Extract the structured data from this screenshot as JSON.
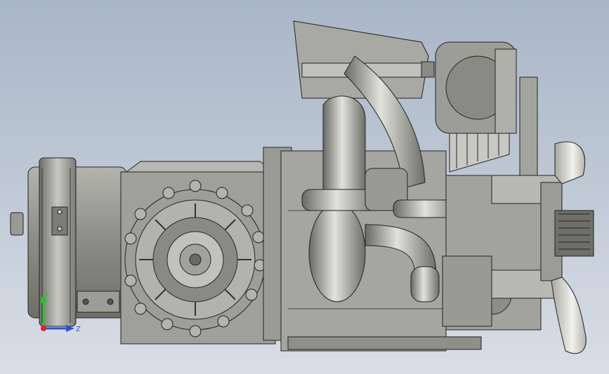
{
  "viewport": {
    "background_top": "#a9b6c8",
    "background_bottom": "#d9dee6"
  },
  "model": {
    "icon": "engine-assembly-model",
    "body_color": "#8f8f8a",
    "edge_color": "#2a2a2a"
  },
  "triad": {
    "x_label": "",
    "y_label": "Y",
    "z_label": "Z",
    "y_color": "#2fbf2f",
    "z_color": "#2f4fd8",
    "origin_color": "#e02020"
  }
}
